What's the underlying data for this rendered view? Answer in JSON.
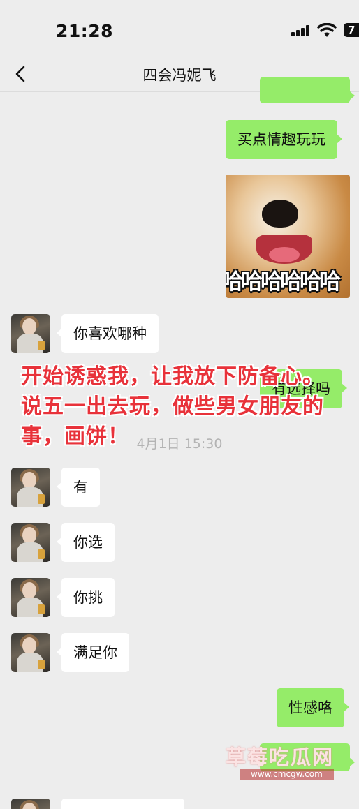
{
  "status_bar": {
    "time": "21:28",
    "battery": "7"
  },
  "nav": {
    "title": "四会冯妮飞"
  },
  "messages": [
    {
      "side": "right",
      "text": "买点情趣玩玩"
    },
    {
      "side": "right",
      "type": "sticker",
      "caption": "哈哈哈哈哈哈"
    },
    {
      "side": "left",
      "text": "你喜欢哪种"
    },
    {
      "side": "right",
      "text": "有选择吗"
    },
    {
      "side": "left",
      "text": "有"
    },
    {
      "side": "left",
      "text": "你选"
    },
    {
      "side": "left",
      "text": "你挑"
    },
    {
      "side": "left",
      "text": "满足你"
    },
    {
      "side": "right",
      "text": "性感咯"
    }
  ],
  "timestamp": "4月1日 15:30",
  "overlay_annotation": "开始诱惑我，让我放下防备心。说五一出去玩，做些男女朋友的事，画饼！",
  "watermark": {
    "title": "草莓吃瓜网",
    "url": "www.cmcgw.com"
  },
  "colors": {
    "background": "#ededed",
    "bubble_self": "#95ec69",
    "bubble_other": "#ffffff",
    "annotation": "#e8323a"
  }
}
